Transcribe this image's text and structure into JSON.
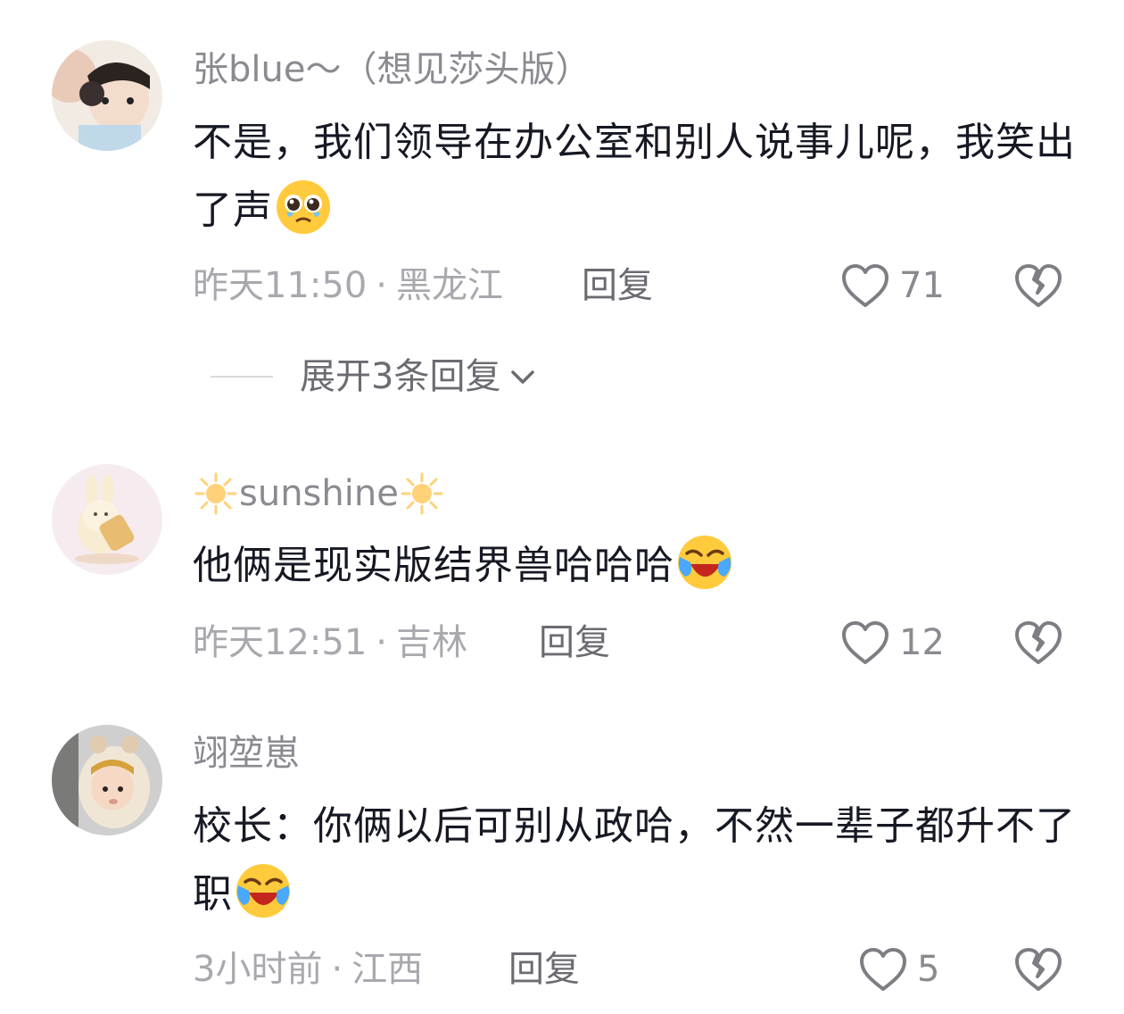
{
  "comments": [
    {
      "username": "张blue～（想见莎头版）",
      "text": "不是，我们领导在办公室和别人说事儿呢，我笑出了声",
      "emoji": "pleading-crying-face",
      "time": "昨天11:50",
      "location": "黑龙江",
      "reply_label": "回复",
      "likes": "71"
    },
    {
      "username_prefix_icon": "sun-icon",
      "username": "sunshine",
      "text": "他俩是现实版结界兽哈哈哈",
      "emoji": "laughing-crying-face",
      "time": "昨天12:51",
      "location": "吉林",
      "reply_label": "回复",
      "likes": "12"
    },
    {
      "username": "翊堃崽",
      "text": "校长：你俩以后可别从政哈，不然一辈子都升不了职",
      "emoji": "laughing-crying-face",
      "time": "3小时前",
      "location": "江西",
      "reply_label": "回复",
      "likes": "5"
    }
  ],
  "expand_replies": "展开3条回复",
  "separator": "·",
  "colors": {
    "text": "#161823",
    "secondary": "#a8a9ae",
    "username": "#8a8b91"
  }
}
